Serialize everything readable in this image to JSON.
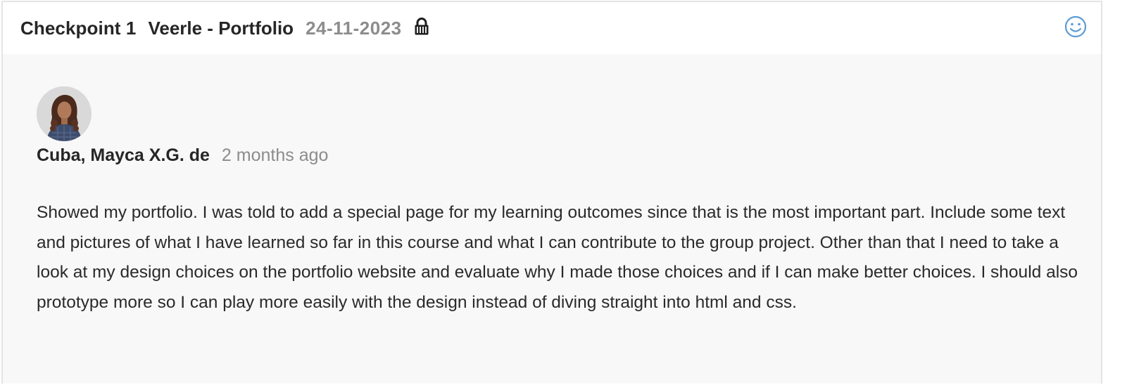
{
  "header": {
    "checkpoint": "Checkpoint 1",
    "project": "Veerle - Portfolio",
    "date": "24-11-2023",
    "lock_icon": "lock-icon",
    "reaction_icon": "smiley-icon"
  },
  "comment": {
    "author": "Cuba, Mayca X.G. de",
    "time_ago": "2 months ago",
    "text": "Showed my portfolio. I was told to add a special page for my learning outcomes since that is the most important part. Include some text and pictures of what I have learned so far in this course and what I can contribute to the group project. Other than that I need to take a look at my design choices on the portfolio website and evaluate why I made those choices and if I can make better choices. I should also prototype more so I can play more easily with the design instead of diving straight into html and css."
  },
  "colors": {
    "accent": "#5b9bd5",
    "muted": "#8c8c8c",
    "text": "#262626",
    "panel": "#f8f8f8"
  }
}
